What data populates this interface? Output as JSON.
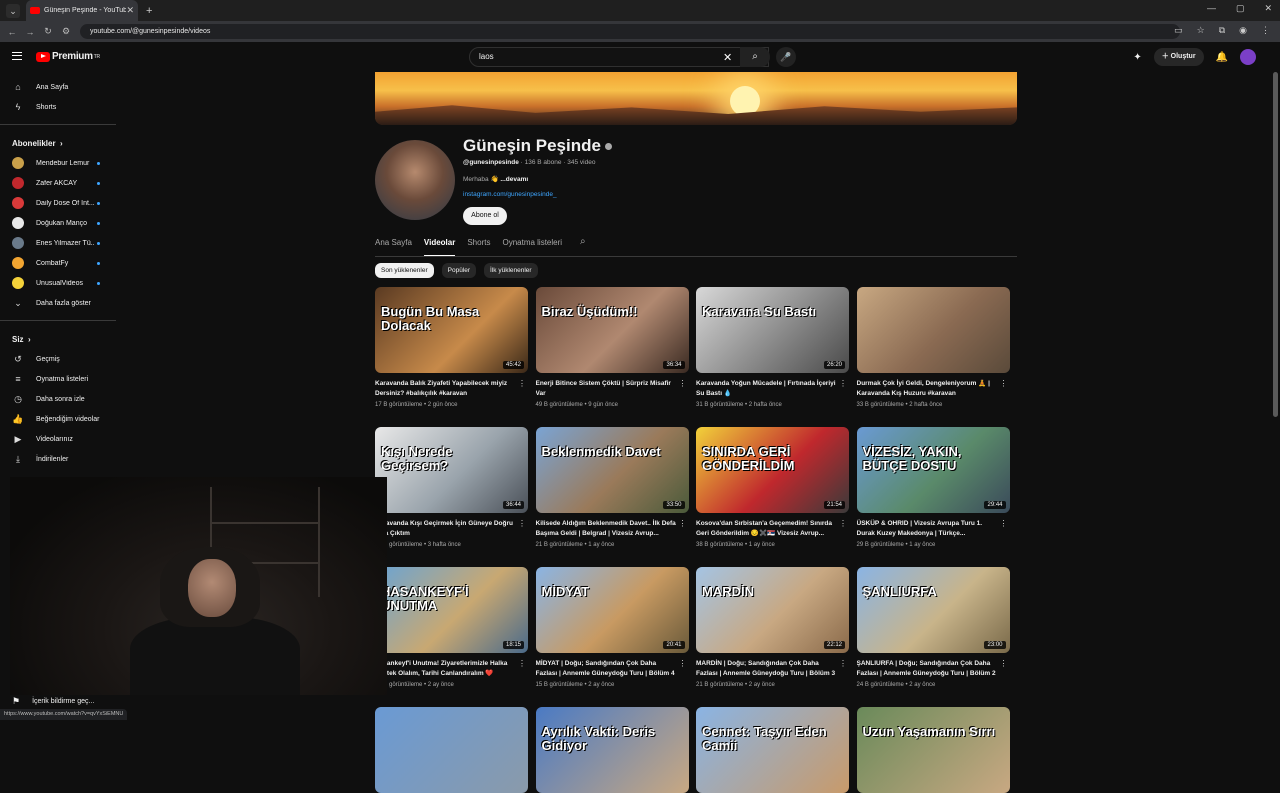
{
  "browser": {
    "tab_title": "Güneşin Peşinde - YouTube",
    "url": "youtube.com/@gunesinpesinde/videos",
    "status_url": "https://www.youtube.com/watch?v=qvYxSiEMNU"
  },
  "header": {
    "logo": "Premium",
    "logo_sup": "TR",
    "search_value": "laos",
    "create_label": "Oluştur"
  },
  "sidebar": {
    "home": "Ana Sayfa",
    "shorts": "Shorts",
    "subs_header": "Abonelikler",
    "subs": [
      {
        "name": "Mendebur Lemur",
        "color": "#c9a04a"
      },
      {
        "name": "Zafer AKCAY",
        "color": "#c0282d"
      },
      {
        "name": "Daily Dose Of Int...",
        "color": "#d93a3a"
      },
      {
        "name": "Doğukan Manço",
        "color": "#e8e8e8"
      },
      {
        "name": "Enes Yilmazer Tü...",
        "color": "#6a7a8a"
      },
      {
        "name": "CombatFy",
        "color": "#f2a531"
      },
      {
        "name": "UnusualVideos",
        "color": "#f4d23a"
      }
    ],
    "more": "Daha fazla göster",
    "you_header": "Siz",
    "you_items": [
      "Geçmiş",
      "Oynatma listeleri",
      "Daha sonra izle",
      "Beğendiğim videolar",
      "Videolarınız",
      "İndirilenler"
    ],
    "report": "İçerik bildirme geç..."
  },
  "channel": {
    "name": "Güneşin Peşinde",
    "handle": "@gunesinpesinde",
    "stats": " · 136 B abone · 345 video",
    "desc": "Merhaba 👋",
    "desc_more": "...devamı",
    "link": "instagram.com/gunesinpesinde_",
    "subscribe": "Abone ol"
  },
  "tabs": [
    "Ana Sayfa",
    "Videolar",
    "Shorts",
    "Oynatma listeleri"
  ],
  "chips": [
    "Son yüklenenler",
    "Popüler",
    "İlk yüklenenler"
  ],
  "videos": [
    {
      "thumb_text": "Bugün Bu Masa Dolacak",
      "dur": "45:42",
      "title": "Karavanda Balık Ziyafeti Yapabilecek miyiz Dersiniz? #balıkçılık #karavan",
      "meta": "17 B görüntüleme • 2 gün önce",
      "bg": "linear-gradient(135deg,#5a3a22,#c78a4a 60%,#3a2818)"
    },
    {
      "thumb_text": "Biraz Üşüdüm!!",
      "dur": "36:34",
      "title": "Enerji Bitince Sistem Çöktü | Sürpriz Misafir Var",
      "meta": "49 B görüntüleme • 9 gün önce",
      "bg": "linear-gradient(135deg,#6a4a3a,#b08870 55%,#3a2a22)"
    },
    {
      "thumb_text": "Karavana Su Bastı",
      "dur": "26:20",
      "title": "Karavanda Yoğun Mücadele | Fırtınada İçeriyi Su Bastı 💧",
      "meta": "31 B görüntüleme • 2 hafta önce",
      "bg": "linear-gradient(135deg,#d8d8d8,#8a8a8a 55%,#4a4a4a)"
    },
    {
      "thumb_text": "",
      "dur": "",
      "title": "Durmak Çok İyi Geldi, Dengeleniyorum 🧘 | Karavanda Kış Huzuru #karavan",
      "meta": "33 B görüntüleme • 2 hafta önce",
      "bg": "linear-gradient(135deg,#c8a882,#8a6a52 55%,#5a4a3a)"
    },
    {
      "thumb_text": "Kışı Nerede Geçirsem?",
      "dur": "36:44",
      "title": "Karavanda Kışı Geçirmek İçin Güneye Doğru Yola Çıktım",
      "meta": "58 B görüntüleme • 3 hafta önce",
      "bg": "linear-gradient(135deg,#e8e8e8,#9aa4ac 55%,#4a5058)"
    },
    {
      "thumb_text": "Beklenmedik Davet",
      "dur": "33:50",
      "title": "Kilisede Aldığım Beklenmedik Davet.. İlk Defa Başıma Geldi | Belgrad | Vizesiz Avrup...",
      "meta": "21 B görüntüleme • 1 ay önce",
      "bg": "linear-gradient(135deg,#7aa4d4,#9a7a5a 55%,#4a5a3a)"
    },
    {
      "thumb_text": "SINIRDA GERİ GÖNDERİLDİM",
      "dur": "21:54",
      "title": "Kosova'dan Sırbistan'a Geçemedim! Sınırda Geri Gönderildim 😔✖️🇷🇸 Vizesiz Avrup...",
      "meta": "38 B görüntüleme • 1 ay önce",
      "bg": "linear-gradient(135deg,#f2d23a,#c0282d 55%,#3a3a3a)"
    },
    {
      "thumb_text": "VİZESİZ, YAKIN, BÜTÇE DOSTU",
      "dur": "29:44",
      "title": "ÜSKÜP & OHRID | Vizesiz Avrupa Turu 1. Durak Kuzey Makedonya | Türkçe...",
      "meta": "29 B görüntüleme • 1 ay önce",
      "bg": "linear-gradient(135deg,#6a9ad4,#5a8a6a 55%,#3a4a5a)"
    },
    {
      "thumb_text": "HASANKEYF'İ UNUTMA",
      "dur": "18:15",
      "title": "Hasankeyf'i Unutma! Ziyaretlerimizle Halka Destek Olalım, Tarihi Canlandıralım ❤️",
      "meta": "53 B görüntüleme • 2 ay önce",
      "bg": "linear-gradient(135deg,#6aa4d4,#c8a872 55%,#4a6a8a)"
    },
    {
      "thumb_text": "MİDYAT",
      "dur": "20:41",
      "title": "MİDYAT | Doğu; Sandığından Çok Daha Fazlası | Annemle Güneydoğu Turu | Bölüm 4",
      "meta": "15 B görüntüleme • 2 ay önce",
      "bg": "linear-gradient(135deg,#8ab4e4,#c89a62 55%,#6a5a3a)"
    },
    {
      "thumb_text": "MARDİN",
      "dur": "22:12",
      "title": "MARDİN | Doğu; Sandığından Çok Daha Fazlası | Annemle Güneydoğu Turu | Bölüm 3",
      "meta": "21 B görüntüleme • 2 ay önce",
      "bg": "linear-gradient(135deg,#a4c4e4,#c8a882 55%,#8a6a4a)"
    },
    {
      "thumb_text": "ŞANLIURFA",
      "dur": "23:00",
      "title": "ŞANLIURFA | Doğu; Sandığından Çok Daha Fazlası | Annemle Güneydoğu Turu | Bölüm 2",
      "meta": "24 B görüntüleme • 2 ay önce",
      "bg": "linear-gradient(135deg,#8ab4e4,#c8b48a 55%,#7a6a4a)"
    },
    {
      "thumb_text": "",
      "dur": "",
      "title": "",
      "meta": "",
      "bg": "linear-gradient(135deg,#6a9ad4,#8a9aaa)"
    },
    {
      "thumb_text": "Ayrılık Vakti: Deris Gidiyor",
      "dur": "",
      "title": "",
      "meta": "",
      "bg": "linear-gradient(135deg,#4a7ac4,#c8a882)"
    },
    {
      "thumb_text": "Cennet: Taşyır Eden Camii",
      "dur": "",
      "title": "",
      "meta": "",
      "bg": "linear-gradient(135deg,#8ab4e4,#c89a6a)"
    },
    {
      "thumb_text": "Uzun Yaşamanın Sırrı",
      "dur": "",
      "title": "",
      "meta": "",
      "bg": "linear-gradient(135deg,#6a8a5a,#c8a882)"
    }
  ]
}
